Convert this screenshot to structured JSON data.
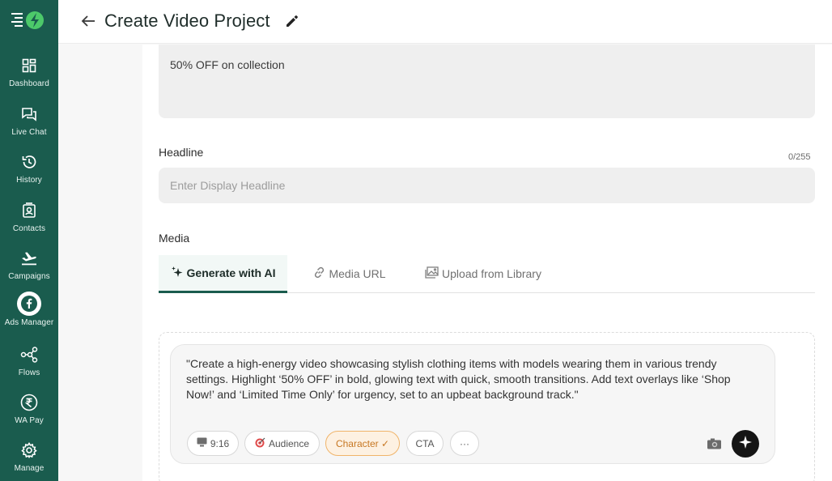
{
  "sidebar": {
    "items": [
      {
        "label": "Dashboard",
        "icon": "dashboard-icon"
      },
      {
        "label": "Live Chat",
        "icon": "chat-icon"
      },
      {
        "label": "History",
        "icon": "history-icon"
      },
      {
        "label": "Contacts",
        "icon": "contacts-icon"
      },
      {
        "label": "Campaigns",
        "icon": "plane-icon"
      },
      {
        "label": "Ads Manager",
        "icon": "facebook-icon"
      },
      {
        "label": "Flows",
        "icon": "flows-icon"
      },
      {
        "label": "WA Pay",
        "icon": "rupee-icon"
      },
      {
        "label": "Manage",
        "icon": "gear-icon"
      }
    ]
  },
  "header": {
    "title": "Create Video Project"
  },
  "form": {
    "description_value": "50% OFF on collection",
    "headline_label": "Headline",
    "headline_counter": "0/255",
    "headline_placeholder": "Enter Display Headline",
    "media_label": "Media"
  },
  "tabs": [
    {
      "label": "Generate with AI",
      "icon": "sparkle-icon",
      "active": true
    },
    {
      "label": "Media URL",
      "icon": "link-icon",
      "active": false
    },
    {
      "label": "Upload from Library",
      "icon": "image-icon",
      "active": false
    }
  ],
  "ai": {
    "prompt": "\"Create a high-energy video showcasing stylish clothing items with models wearing them in various trendy settings. Highlight ‘50% OFF’ in bold, glowing text with quick, smooth transitions. Add text overlays like ‘Shop Now!’ and ‘Limited Time Only’ for urgency, set to an upbeat background track.\"",
    "chips": [
      {
        "label": "9:16",
        "prefix": "🖥",
        "highlighted": false
      },
      {
        "label": "Audience",
        "prefix": "🎯",
        "highlighted": false
      },
      {
        "label": "Character ✓",
        "prefix": "",
        "highlighted": true
      },
      {
        "label": "CTA",
        "prefix": "",
        "highlighted": false
      },
      {
        "label": "···",
        "prefix": "",
        "highlighted": false
      }
    ]
  },
  "colors": {
    "sidebar_bg": "#1a5c4e",
    "accent": "#1a5c4e",
    "chip_highlight": "#f0b46a"
  }
}
